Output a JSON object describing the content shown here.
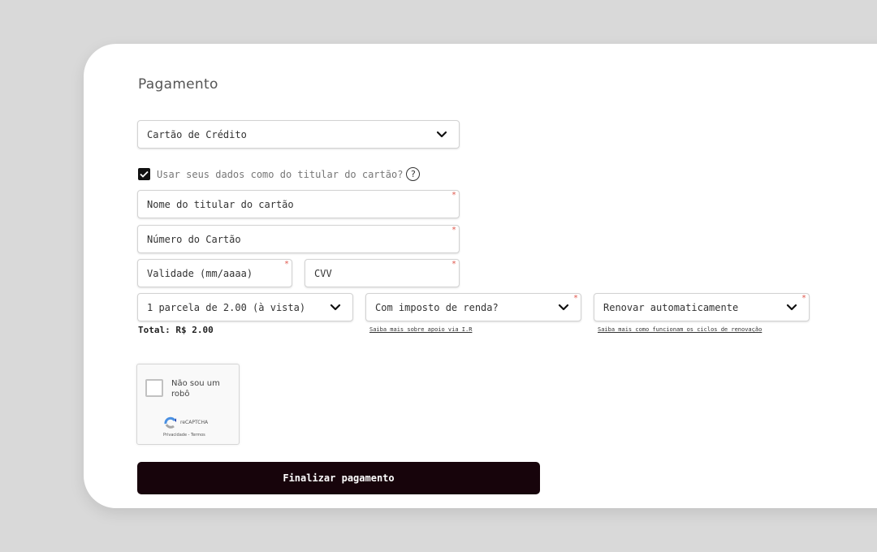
{
  "payment": {
    "title": "Pagamento",
    "method_select": {
      "value": "Cartão de Crédito"
    },
    "use_holder_data": {
      "checked": true,
      "label": "Usar seus dados como do titular do cartão?",
      "help_glyph": "?"
    },
    "fields": {
      "holder_name": {
        "placeholder": "Nome do titular do cartão",
        "required_mark": "*"
      },
      "card_number": {
        "placeholder": "Número do Cartão",
        "required_mark": "*"
      },
      "expiry": {
        "placeholder": "Validade (mm/aaaa)",
        "required_mark": "*"
      },
      "cvv": {
        "placeholder": "CVV",
        "required_mark": "*"
      }
    },
    "installments_select": {
      "value": "1 parcela de 2.00 (à vista)"
    },
    "tax_select": {
      "value": "Com imposto de renda?",
      "required_mark": "*"
    },
    "renew_select": {
      "value": "Renovar automaticamente",
      "required_mark": "*"
    },
    "total": "Total: R$ 2.00",
    "tax_link": "Saiba mais sobre apoio via I.R",
    "renew_link": "Saiba mais como funcionam os ciclos de renovação",
    "submit_label": "Finalizar pagamento"
  },
  "captcha": {
    "label": "Não sou um robô",
    "brand": "reCAPTCHA",
    "terms": "Privacidade - Termos"
  },
  "colors": {
    "background": "#d9d9d9",
    "card": "#ffffff",
    "submit": "#17040b",
    "required": "#e05a4f"
  }
}
